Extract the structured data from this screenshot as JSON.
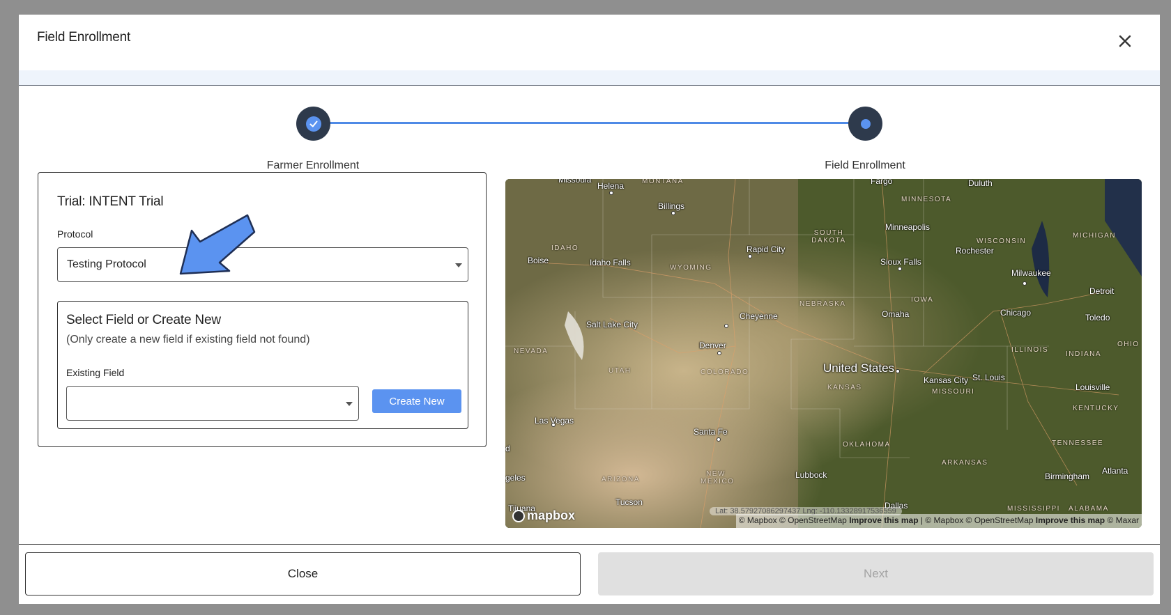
{
  "modal": {
    "title": "Field Enrollment",
    "close_icon": "close-icon"
  },
  "stepper": {
    "steps": [
      {
        "label": "Farmer Enrollment",
        "state": "completed",
        "icon": "check-icon"
      },
      {
        "label": "Field Enrollment",
        "state": "active",
        "icon": "dot-icon"
      }
    ],
    "line_color": "#4f8ae6",
    "accent_color": "#5b93f0"
  },
  "form": {
    "trial_title": "Trial: INTENT Trial",
    "protocol_label": "Protocol",
    "protocol_value": "Testing Protocol",
    "field_section_title": "Select Field or Create New",
    "field_section_subtitle": "(Only create a new field if existing field not found)",
    "existing_field_label": "Existing Field",
    "existing_field_value": "",
    "create_new_label": "Create New"
  },
  "map": {
    "country_label": "United States",
    "cities": [
      "Missoula",
      "Helena",
      "Fargo",
      "Duluth",
      "Billings",
      "Minneapolis",
      "Rapid City",
      "Rochester",
      "Boise",
      "Idaho Falls",
      "Sioux Falls",
      "Milwaukee",
      "Detroit",
      "Chicago",
      "Toledo",
      "Omaha",
      "Salt Lake City",
      "Cheyenne",
      "Denver",
      "Kansas City",
      "St. Louis",
      "Louisville",
      "Las Vegas",
      "Santa Fe",
      "Lubbock",
      "Birmingham",
      "Atlanta",
      "Tucson",
      "Dallas",
      "Tijuana"
    ],
    "states": [
      "MONTANA",
      "MINNESOTA",
      "SOUTH DAKOTA",
      "WISCONSIN",
      "MICHIGAN",
      "IDAHO",
      "WYOMING",
      "NEBRASKA",
      "IOWA",
      "NEVADA",
      "UTAH",
      "COLORADO",
      "KANSAS",
      "MISSOURI",
      "ILLINOIS",
      "INDIANA",
      "OHIO",
      "KENTUCKY",
      "OKLAHOMA",
      "ARKANSAS",
      "TENNESSEE",
      "ARIZONA",
      "NEW MEXICO",
      "MISSISSIPPI",
      "ALABAMA"
    ],
    "fragments": [
      "d",
      "geles"
    ],
    "logo_text": "mapbox",
    "coords_text": "Lat: 38.57927086297437 Lng: -110.13328917536559",
    "attribution_parts": [
      "© Mapbox © OpenStreetMap",
      "Improve this map",
      "| © Mapbox © OpenStreetMap",
      "Improve this map",
      "© Maxar"
    ]
  },
  "footer": {
    "close_label": "Close",
    "next_label": "Next"
  }
}
